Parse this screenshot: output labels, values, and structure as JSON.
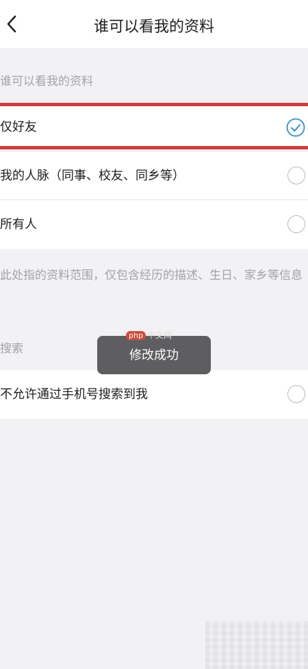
{
  "nav": {
    "title": "谁可以看我的资料"
  },
  "profile_section": {
    "label": "谁可以看我的资料",
    "options": [
      {
        "label": "仅好友",
        "selected": true
      },
      {
        "label": "我的人脉（同事、校友、同乡等）",
        "selected": false
      },
      {
        "label": "所有人",
        "selected": false
      }
    ],
    "note": "此处指的资料范围，仅包含经历的描述、生日、家乡等信息"
  },
  "search_section": {
    "label": "搜索",
    "options": [
      {
        "label": "不允许通过手机号搜索到我",
        "selected": false
      }
    ]
  },
  "toast": {
    "message": "修改成功"
  },
  "watermark": {
    "logo": "php",
    "text": "中文网"
  },
  "colors": {
    "accent": "#2d8fd0",
    "highlight": "#d43a3a",
    "muted_text": "#a3a3a6",
    "background": "#f2f2f4"
  },
  "icons": {
    "back": "chevron-left-icon",
    "checked": "check-circle-icon",
    "unchecked": "empty-circle-icon"
  }
}
